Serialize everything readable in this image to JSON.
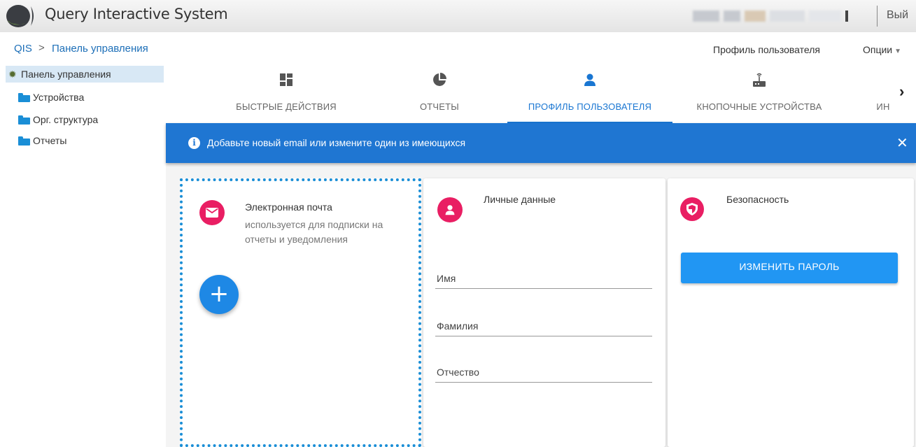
{
  "header": {
    "app_title": "Query Interactive System",
    "logout_label": "Вый"
  },
  "breadcrumb": {
    "root": "QIS",
    "separator": ">",
    "current": "Панель управления"
  },
  "top_nav": {
    "profile_label": "Профиль пользователя",
    "options_label": "Опции"
  },
  "sidebar": {
    "root_label": "Панель управления",
    "items": [
      {
        "label": "Устройства"
      },
      {
        "label": "Орг. структура"
      },
      {
        "label": "Отчеты"
      }
    ]
  },
  "tabs": [
    {
      "label": "БЫСТРЫЕ ДЕЙСТВИЯ",
      "icon": "dashboard-icon",
      "active": false
    },
    {
      "label": "ОТЧЕТЫ",
      "icon": "pie-chart-icon",
      "active": false
    },
    {
      "label": "ПРОФИЛЬ ПОЛЬЗОВАТЕЛЯ",
      "icon": "person-icon",
      "active": true
    },
    {
      "label": "КНОПОЧНЫЕ УСТРОЙСТВА",
      "icon": "router-icon",
      "active": false
    },
    {
      "label": "ИН",
      "icon": "",
      "active": false
    }
  ],
  "banner": {
    "message": "Добавьте новый email или измените один из имеющихся",
    "close": "✕"
  },
  "email_card": {
    "title": "Электронная почта",
    "subtitle": "используется для подписки на отчеты и уведомления",
    "add_symbol": "+"
  },
  "personal_card": {
    "title": "Личные данные",
    "fields": [
      {
        "label": "Имя"
      },
      {
        "label": "Фамилия"
      },
      {
        "label": "Отчество"
      }
    ]
  },
  "security_card": {
    "title": "Безопасность",
    "button_label": "ИЗМЕНИТЬ ПАРОЛЬ"
  },
  "colors": {
    "primary": "#1f76d2",
    "accent": "#e91e63",
    "button": "#2196f3",
    "link": "#1d6fb8"
  }
}
